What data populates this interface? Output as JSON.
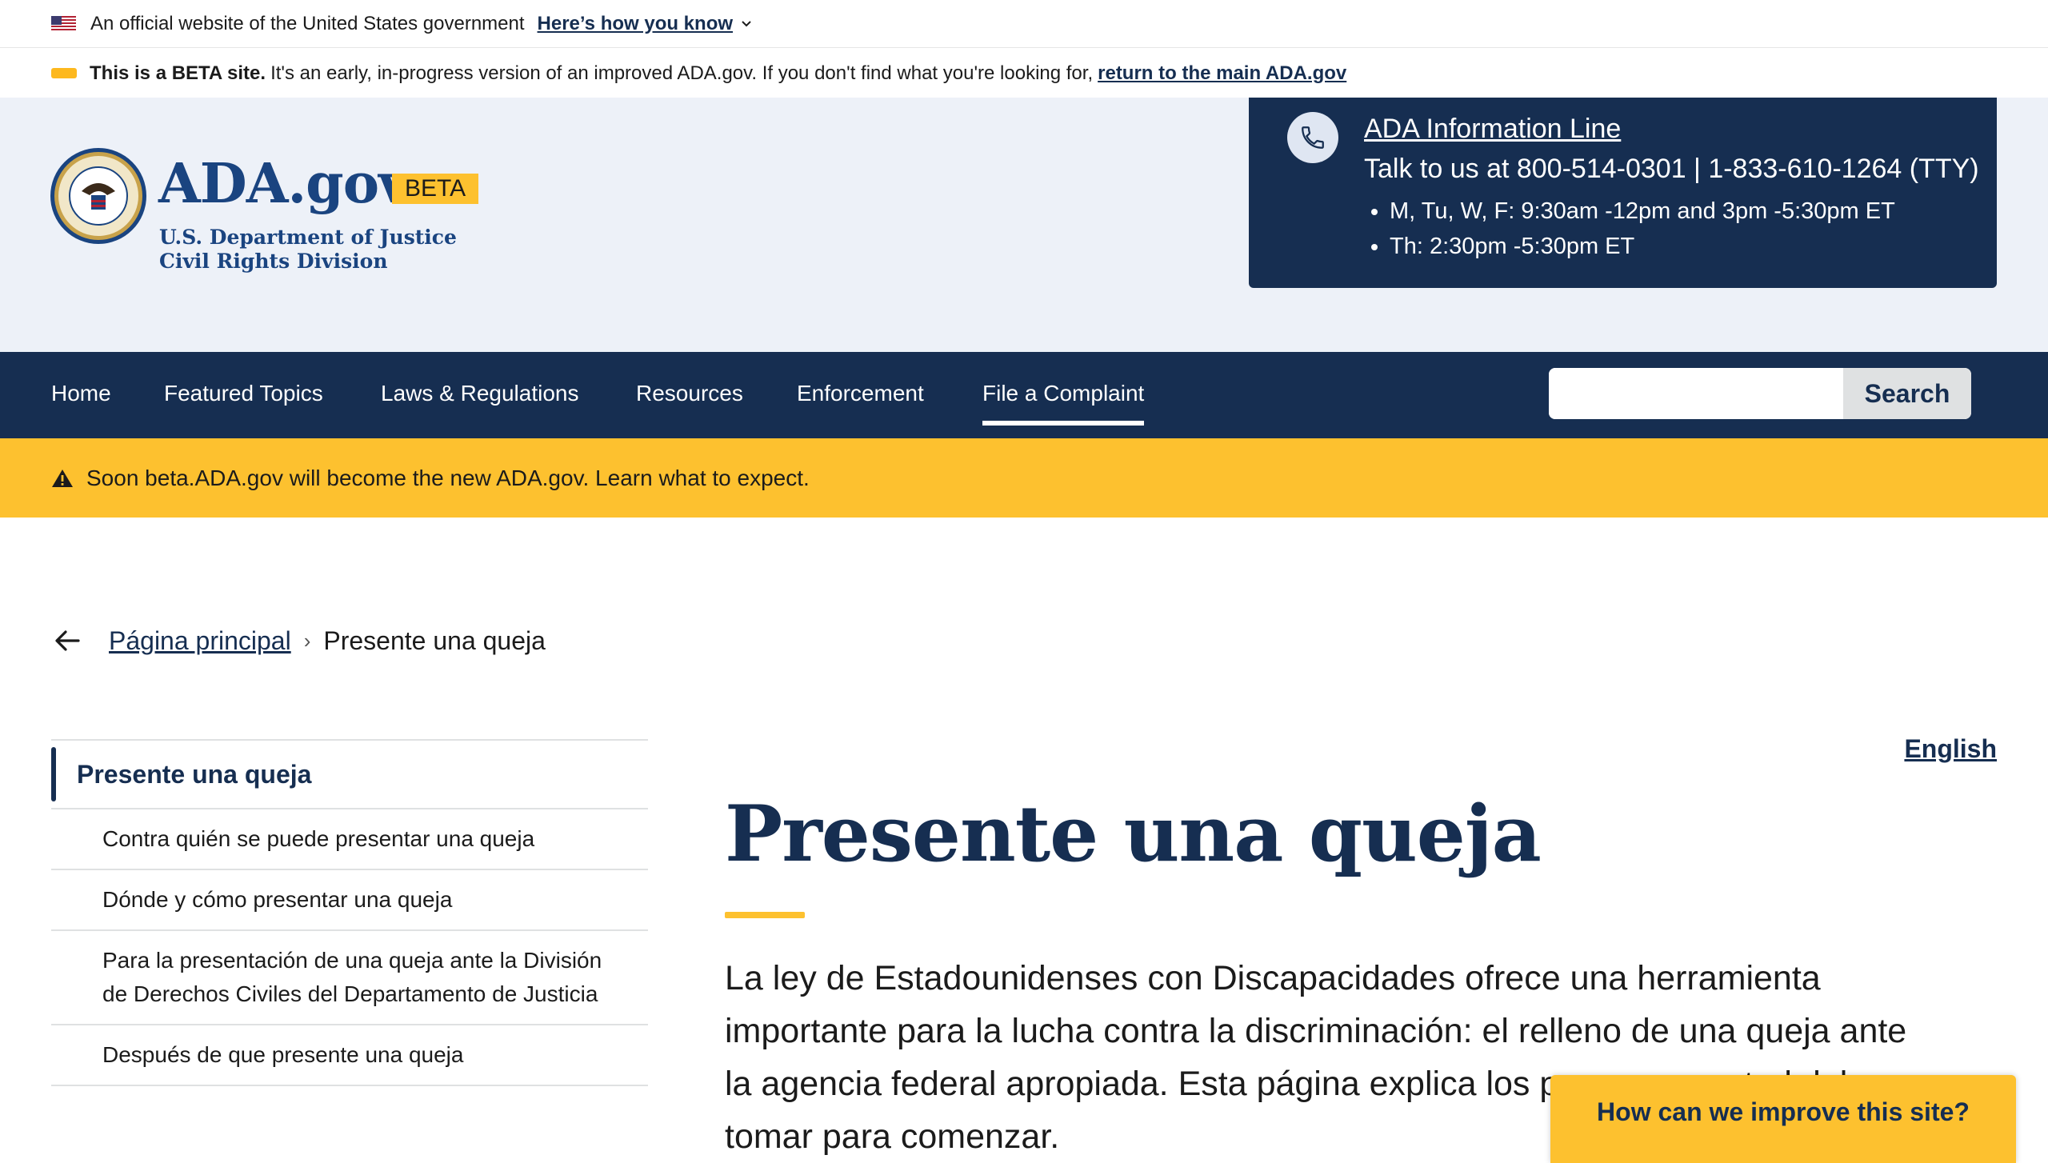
{
  "gov_banner": {
    "official_text": "An official website of the United States government",
    "how_you_know": "Here’s how you know"
  },
  "beta_banner": {
    "bold": "This is a BETA site.",
    "text": "It's an early, in-progress version of an improved ADA.gov. If you don't find what you're looking for,",
    "link": "return to the main ADA.gov"
  },
  "header": {
    "logo_title": "ADA.gov",
    "beta_badge": "BETA",
    "dept_line1": "U.S. Department of Justice",
    "dept_line2": "Civil Rights Division",
    "info_line": {
      "title": "ADA Information Line",
      "talk": "Talk to us at 800-514-0301 | 1-833-610-1264 (TTY)",
      "hours": [
        "M, Tu, W, F: 9:30am -12pm and 3pm -5:30pm ET",
        "Th: 2:30pm -5:30pm ET"
      ]
    }
  },
  "nav": {
    "items": [
      "Home",
      "Featured Topics",
      "Laws & Regulations",
      "Resources",
      "Enforcement",
      "File a Complaint"
    ],
    "active": "File a Complaint",
    "search_button": "Search",
    "search_value": ""
  },
  "alert": {
    "text": "Soon beta.ADA.gov will become the new ADA.gov. Learn what to expect."
  },
  "breadcrumb": {
    "home": "Página principal",
    "current": "Presente una queja"
  },
  "sidenav": {
    "current": "Presente una queja",
    "items": [
      "Contra quién se puede presentar una queja",
      "Dónde y cómo presentar una queja",
      "Para la presentación de una queja ante la División de Derechos Civiles del Departamento de Justicia",
      "Después de que presente una queja"
    ]
  },
  "main": {
    "language_link": "English",
    "title": "Presente una queja",
    "lede": "La ley de Estadounidenses con Discapacidades ofrece una herramienta importante para la lucha contra la discriminación: el relleno de una queja ante la agencia federal apropiada. Esta página explica los pasos que usted debe tomar para comenzar."
  },
  "feedback": {
    "label": "How can we improve this site?"
  },
  "colors": {
    "primary_dark": "#162e51",
    "primary": "#1a4480",
    "accent_gold": "#fdc12f",
    "header_bg": "#edf1f8"
  }
}
